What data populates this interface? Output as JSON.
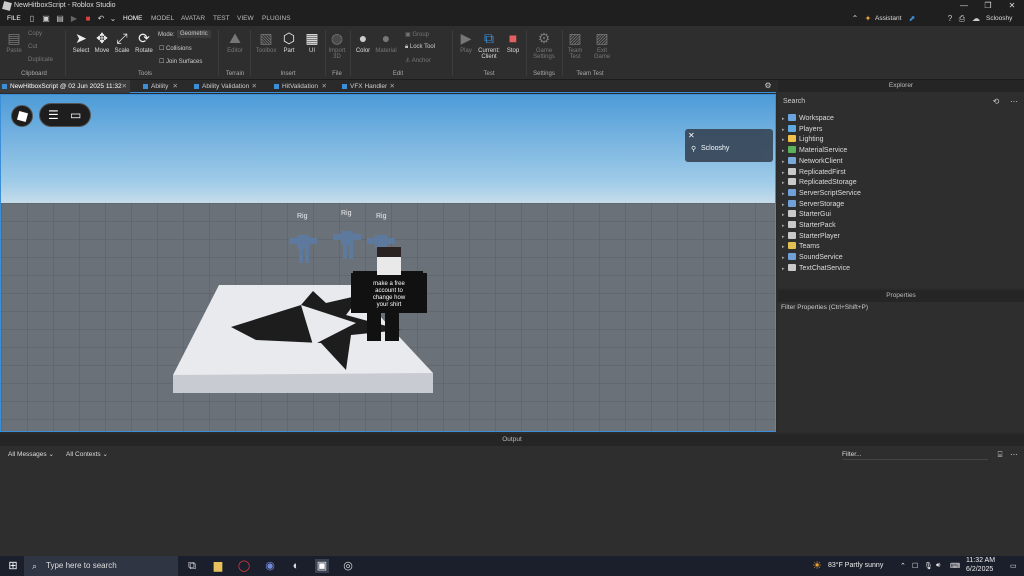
{
  "window": {
    "title": "NewHitboxScript - Roblox Studio",
    "minimize": "—",
    "maximize": "❐",
    "close": "✕"
  },
  "menubar": {
    "file": "FILE",
    "tabs": [
      "HOME",
      "MODEL",
      "AVATAR",
      "TEST",
      "VIEW",
      "PLUGINS"
    ],
    "assistant": "Assistant",
    "user": "Sclooshy"
  },
  "ribbon": {
    "clipboard": {
      "paste": "Paste",
      "copy": "Copy",
      "cut": "Cut",
      "duplicate": "Duplicate",
      "group": "Clipboard"
    },
    "tools": {
      "select": "Select",
      "move": "Move",
      "scale": "Scale",
      "rotate": "Rotate",
      "mode_label": "Mode:",
      "mode_value": "Geometric",
      "collisions": "Collisions",
      "join_surfaces": "Join Surfaces",
      "group": "Tools"
    },
    "terrain": {
      "editor": "Editor",
      "group": "Terrain"
    },
    "insert": {
      "toolbox": "Toolbox",
      "part": "Part",
      "ui": "UI",
      "group": "Insert"
    },
    "file": {
      "import3d": "Import 3D",
      "group": "File"
    },
    "edit": {
      "color": "Color",
      "material": "Material",
      "group_btn": "Group",
      "lock_tool": "Lock Tool",
      "anchor": "Anchor",
      "group": "Edit"
    },
    "test": {
      "play": "Play",
      "current_client": "Current: Client",
      "stop": "Stop",
      "group": "Test"
    },
    "settings": {
      "game_settings": "Game Settings",
      "group": "Settings"
    },
    "team_test": {
      "team_test": "Team Test",
      "exit_game": "Exit Game",
      "group": "Team Test"
    }
  },
  "doc_tabs": [
    "NewHitboxScript @ 02 Jun 2025 11:32",
    "Ability",
    "Ability Validation",
    "HitValidation",
    "VFX Handler"
  ],
  "viewport": {
    "player_name": "Sclooshy",
    "rig_labels": [
      "Rig",
      "Rig",
      "Rig"
    ],
    "shirt_text": "make a free account to change how your shirt"
  },
  "explorer": {
    "header": "Explorer",
    "search_placeholder": "Search",
    "items": [
      "Workspace",
      "Players",
      "Lighting",
      "MaterialService",
      "NetworkClient",
      "ReplicatedFirst",
      "ReplicatedStorage",
      "ServerScriptService",
      "ServerStorage",
      "StarterGui",
      "StarterPack",
      "StarterPlayer",
      "Teams",
      "SoundService",
      "TextChatService"
    ],
    "icon_colors": [
      "#6ba5e0",
      "#5fa9e2",
      "#f0c04a",
      "#5ab25c",
      "#7aa8d8",
      "#c9c9c9",
      "#c9c9c9",
      "#6fa0d8",
      "#6fa0d8",
      "#c9c9c9",
      "#c9c9c9",
      "#c9c9c9",
      "#e0c050",
      "#6fa0d8",
      "#c9c9c9"
    ]
  },
  "properties": {
    "header": "Properties",
    "filter": "Filter Properties (Ctrl+Shift+P)"
  },
  "output": {
    "header": "Output",
    "messages": "All Messages",
    "contexts": "All Contexts",
    "filter": "Filter..."
  },
  "taskbar": {
    "search_placeholder": "Type here to search",
    "weather": "83°F  Partly sunny",
    "time": "11:32 AM",
    "date": "6/2/2025"
  }
}
